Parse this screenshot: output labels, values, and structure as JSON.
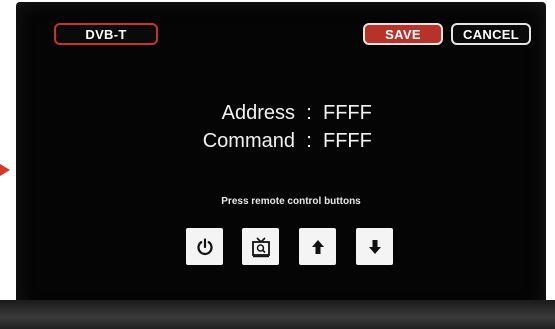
{
  "header": {
    "mode_label": "DVB-T",
    "save_label": "SAVE",
    "cancel_label": "CANCEL"
  },
  "ir_code": {
    "address_label": "Address",
    "address_value": "FFFF",
    "command_label": "Command",
    "command_value": "FFFF",
    "separator": ":"
  },
  "hint_text": "Press remote control buttons",
  "remote_keys": [
    {
      "icon": "power-icon"
    },
    {
      "icon": "tv-guide-icon"
    },
    {
      "icon": "arrow-up-icon"
    },
    {
      "icon": "arrow-down-icon"
    }
  ],
  "colors": {
    "accent_red": "#b8322a",
    "screen_bg": "#050505",
    "text": "#f2f2f2"
  }
}
